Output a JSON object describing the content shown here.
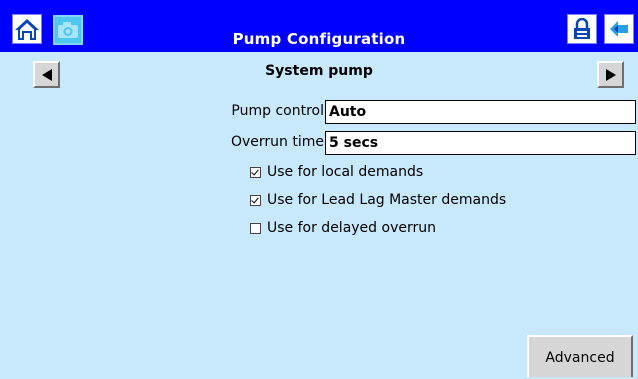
{
  "header": {
    "title": "Pump Configuration",
    "home_icon": "home-icon",
    "camera_icon": "camera-icon",
    "lock_icon": "lock-icon",
    "back_icon": "back-arrow-icon"
  },
  "section": {
    "title": "System pump",
    "prev_icon": "left-arrow-icon",
    "next_icon": "right-arrow-icon"
  },
  "fields": {
    "pump_control": {
      "label": "Pump control",
      "value": "Auto"
    },
    "overrun_time": {
      "label": "Overrun time",
      "value": "5 secs"
    }
  },
  "options": [
    {
      "label": "Use for local demands",
      "checked": true
    },
    {
      "label": "Use for Lead Lag Master demands",
      "checked": true
    },
    {
      "label": "Use for delayed overrun",
      "checked": false
    }
  ],
  "footer": {
    "advanced_label": "Advanced"
  },
  "colors": {
    "titlebar": "#0000ff",
    "background": "#c8e8fb"
  }
}
